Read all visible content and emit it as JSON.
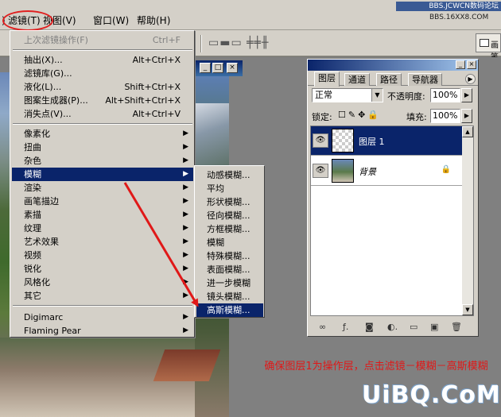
{
  "menubar": {
    "edge": ")",
    "filter": "滤镜(T)",
    "view": "视图(V)",
    "window": "窗口(W)",
    "help": "帮助(H)",
    "watermark_top": "BBS.JCWCN数码论坛",
    "watermark_top2": "BBS.16XX8.COM"
  },
  "options_bar": {
    "align_icons": "를퓾퓿 ⫼⫼ǁǁ",
    "dock_label": "画笔"
  },
  "filter_menu": {
    "items": [
      {
        "label": "上次滤镜操作(F)",
        "shortcut": "Ctrl+F",
        "disabled": true
      },
      {
        "label": "抽出(X)...",
        "shortcut": "Alt+Ctrl+X"
      },
      {
        "label": "滤镜库(G)..."
      },
      {
        "label": "液化(L)...",
        "shortcut": "Shift+Ctrl+X"
      },
      {
        "label": "图案生成器(P)...",
        "shortcut": "Alt+Shift+Ctrl+X"
      },
      {
        "label": "消失点(V)...",
        "shortcut": "Alt+Ctrl+V"
      },
      {
        "label": "像素化",
        "arrow": "▶"
      },
      {
        "label": "扭曲",
        "arrow": "▶"
      },
      {
        "label": "杂色",
        "arrow": "▶"
      },
      {
        "label": "模糊",
        "arrow": "▶",
        "highlighted": true
      },
      {
        "label": "渲染",
        "arrow": "▶"
      },
      {
        "label": "画笔描边",
        "arrow": "▶"
      },
      {
        "label": "素描",
        "arrow": "▶"
      },
      {
        "label": "纹理",
        "arrow": "▶"
      },
      {
        "label": "艺术效果",
        "arrow": "▶"
      },
      {
        "label": "视频",
        "arrow": "▶"
      },
      {
        "label": "锐化",
        "arrow": "▶"
      },
      {
        "label": "风格化",
        "arrow": "▶"
      },
      {
        "label": "其它",
        "arrow": "▶"
      },
      {
        "label": "Digimarc",
        "arrow": "▶"
      },
      {
        "label": "Flaming Pear",
        "arrow": "▶"
      }
    ]
  },
  "blur_menu": {
    "items": [
      {
        "label": "动感模糊..."
      },
      {
        "label": "平均"
      },
      {
        "label": "形状模糊..."
      },
      {
        "label": "径向模糊..."
      },
      {
        "label": "方框模糊..."
      },
      {
        "label": "模糊"
      },
      {
        "label": "特殊模糊..."
      },
      {
        "label": "表面模糊..."
      },
      {
        "label": "进一步模糊"
      },
      {
        "label": "镜头模糊..."
      },
      {
        "label": "高斯模糊...",
        "highlighted": true
      }
    ]
  },
  "layers_palette": {
    "tabs": [
      "图层",
      "通道",
      "路径",
      "导航器"
    ],
    "blend_mode": "正常",
    "opacity_label": "不透明度:",
    "opacity_value": "100%",
    "lock_label": "锁定:",
    "fill_label": "填充:",
    "fill_value": "100%",
    "layers": [
      {
        "name": "图层 1",
        "selected": true,
        "visible": true
      },
      {
        "name": "背景",
        "selected": false,
        "visible": true,
        "locked": true
      }
    ]
  },
  "caption": "确保图层1为操作层，点击滤镜－模糊－高斯模糊",
  "watermark": "UiBQ.CoM",
  "colors": {
    "menu_bg": "#d4d0c8",
    "highlight": "#0a246a",
    "annotation_red": "#e01818"
  }
}
